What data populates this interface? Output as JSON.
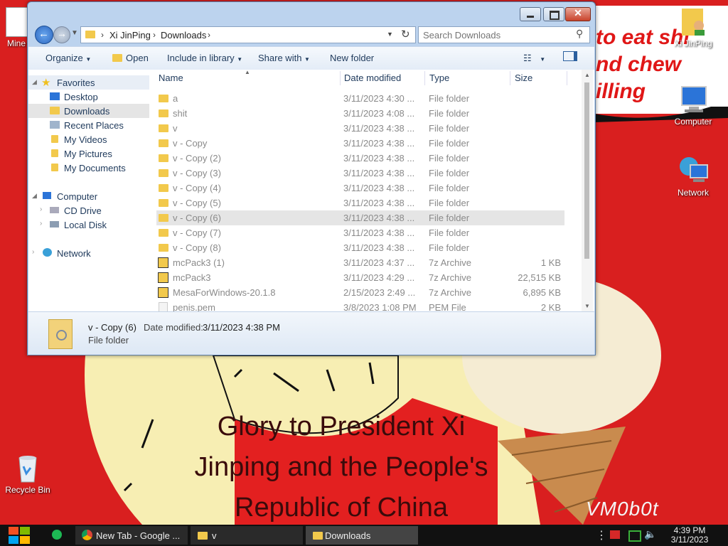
{
  "desktop": {
    "wallpaper_caption": "Glory to President Xi Jinping and the People's Republic of China",
    "bubble_lines": [
      "to eat shi",
      "nd chew",
      "illing"
    ],
    "watermark": "VM0b0t",
    "icons": [
      {
        "label": "Mine",
        "icon": "app-icon"
      },
      {
        "label": "Xi JinPing",
        "icon": "user-folder-icon"
      },
      {
        "label": "Computer",
        "icon": "computer-icon"
      },
      {
        "label": "Network",
        "icon": "network-icon"
      },
      {
        "label": "Recycle Bin",
        "icon": "recycle-bin-icon"
      }
    ]
  },
  "window": {
    "breadcrumb": [
      "Xi JinPing",
      "Downloads"
    ],
    "search_placeholder": "Search Downloads",
    "toolbar": {
      "organize": "Organize",
      "open": "Open",
      "include": "Include in library",
      "share": "Share with",
      "new_folder": "New folder"
    },
    "nav": {
      "favorites": "Favorites",
      "desktop": "Desktop",
      "downloads": "Downloads",
      "recent": "Recent Places",
      "videos": "My Videos",
      "pictures": "My Pictures",
      "documents": "My Documents",
      "computer": "Computer",
      "cd": "CD Drive",
      "local": "Local Disk",
      "network": "Network"
    },
    "columns": {
      "name": "Name",
      "date": "Date modified",
      "type": "Type",
      "size": "Size"
    },
    "files": [
      {
        "name": "a",
        "date": "3/11/2023 4:30 ...",
        "type": "File folder",
        "size": "",
        "kind": "folder"
      },
      {
        "name": "shit",
        "date": "3/11/2023 4:08 ...",
        "type": "File folder",
        "size": "",
        "kind": "folder"
      },
      {
        "name": "v",
        "date": "3/11/2023 4:38 ...",
        "type": "File folder",
        "size": "",
        "kind": "folder"
      },
      {
        "name": "v - Copy",
        "date": "3/11/2023 4:38 ...",
        "type": "File folder",
        "size": "",
        "kind": "folder"
      },
      {
        "name": "v - Copy (2)",
        "date": "3/11/2023 4:38 ...",
        "type": "File folder",
        "size": "",
        "kind": "folder"
      },
      {
        "name": "v - Copy (3)",
        "date": "3/11/2023 4:38 ...",
        "type": "File folder",
        "size": "",
        "kind": "folder"
      },
      {
        "name": "v - Copy (4)",
        "date": "3/11/2023 4:38 ...",
        "type": "File folder",
        "size": "",
        "kind": "folder"
      },
      {
        "name": "v - Copy (5)",
        "date": "3/11/2023 4:38 ...",
        "type": "File folder",
        "size": "",
        "kind": "folder"
      },
      {
        "name": "v - Copy (6)",
        "date": "3/11/2023 4:38 ...",
        "type": "File folder",
        "size": "",
        "kind": "folder",
        "selected": true
      },
      {
        "name": "v - Copy (7)",
        "date": "3/11/2023 4:38 ...",
        "type": "File folder",
        "size": "",
        "kind": "folder"
      },
      {
        "name": "v - Copy (8)",
        "date": "3/11/2023 4:38 ...",
        "type": "File folder",
        "size": "",
        "kind": "folder"
      },
      {
        "name": "mcPack3 (1)",
        "date": "3/11/2023 4:37 ...",
        "type": "7z Archive",
        "size": "1 KB",
        "kind": "archive"
      },
      {
        "name": "mcPack3",
        "date": "3/11/2023 4:29 ...",
        "type": "7z Archive",
        "size": "22,515 KB",
        "kind": "archive"
      },
      {
        "name": "MesaForWindows-20.1.8",
        "date": "2/15/2023 2:49 ...",
        "type": "7z Archive",
        "size": "6,895 KB",
        "kind": "archive"
      },
      {
        "name": "penis.pem",
        "date": "3/8/2023 1:08 PM",
        "type": "PEM File",
        "size": "2 KB",
        "kind": "file"
      }
    ],
    "details": {
      "name": "v - Copy (6)",
      "date_label": "Date modified:",
      "date_value": "3/11/2023 4:38 PM",
      "type": "File folder"
    }
  },
  "taskbar": {
    "items": [
      {
        "label": "New Tab - Google ...",
        "icon": "chrome-icon"
      },
      {
        "label": "v",
        "icon": "folder-icon"
      },
      {
        "label": "Downloads",
        "icon": "folder-icon",
        "active": true
      }
    ],
    "time": "4:39 PM",
    "date": "3/11/2023"
  },
  "colors": {
    "wallpaper_red": "#d91f1f",
    "window_frame": "#bcd3ee",
    "taskbar": "#111111",
    "selection": "#e5e5e5"
  }
}
